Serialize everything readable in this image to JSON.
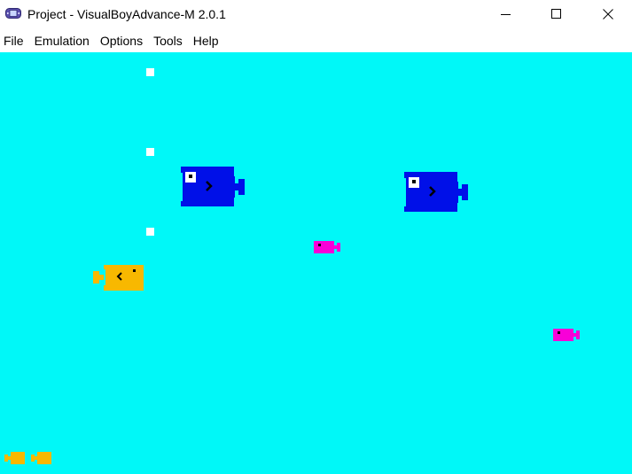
{
  "window": {
    "title": "Project - VisualBoyAdvance-M 2.0.1",
    "app_icon": "gameboy-advance-icon"
  },
  "window_controls": {
    "minimize_icon": "minimize-icon",
    "maximize_icon": "maximize-icon",
    "close_icon": "close-icon"
  },
  "menu": {
    "items": [
      {
        "label": "File"
      },
      {
        "label": "Emulation"
      },
      {
        "label": "Options"
      },
      {
        "label": "Tools"
      },
      {
        "label": "Help"
      }
    ]
  },
  "game": {
    "background_color": "#00f8f8",
    "colors": {
      "big_fish": "#0010e8",
      "player_fish": "#f8b800",
      "small_fish": "#f800d8",
      "pellet": "#ffffff"
    },
    "sprites": {
      "pellets": 3,
      "big_fish": 2,
      "small_pink_fish": 2,
      "player_fish": 1,
      "lives": 2
    }
  }
}
